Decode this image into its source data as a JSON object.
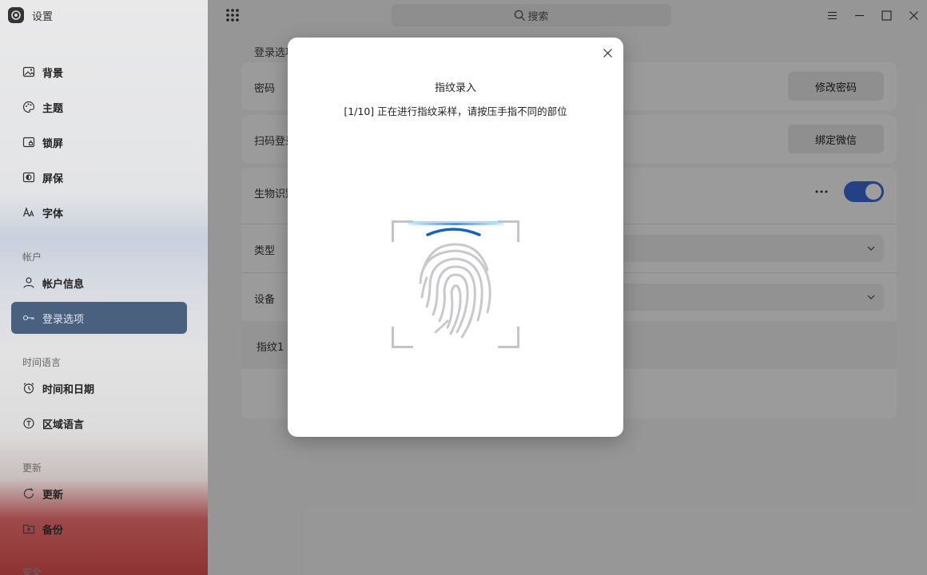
{
  "app": {
    "title": "设置",
    "icon": "settings-app-icon"
  },
  "sidebar": {
    "items": [
      {
        "label": "背景",
        "icon": "image-icon"
      },
      {
        "label": "主题",
        "icon": "palette-icon"
      },
      {
        "label": "锁屏",
        "icon": "lockscreen-icon"
      },
      {
        "label": "屏保",
        "icon": "screensaver-icon"
      },
      {
        "label": "字体",
        "icon": "font-icon"
      }
    ],
    "sections": [
      {
        "title": "帐户",
        "items": [
          {
            "label": "帐户信息",
            "icon": "user-icon"
          },
          {
            "label": "登录选项",
            "icon": "key-icon",
            "active": true
          }
        ]
      },
      {
        "title": "时间语言",
        "items": [
          {
            "label": "时间和日期",
            "icon": "clock-icon"
          },
          {
            "label": "区域语言",
            "icon": "language-icon"
          }
        ]
      },
      {
        "title": "更新",
        "items": [
          {
            "label": "更新",
            "icon": "refresh-icon"
          },
          {
            "label": "备份",
            "icon": "backup-icon"
          }
        ]
      },
      {
        "title": "安全"
      }
    ]
  },
  "topbar": {
    "search_placeholder": "搜索",
    "icons": [
      "app-grid-icon",
      "menu-icon",
      "minimize-icon",
      "maximize-icon",
      "close-icon"
    ]
  },
  "main": {
    "breadcrumb": "登录选项",
    "password": {
      "label": "密码",
      "button": "修改密码"
    },
    "qrcode": {
      "label": "扫码登录",
      "button": "绑定微信"
    },
    "biometric": {
      "label": "生物识别",
      "toggle_on": true
    },
    "type": {
      "label": "类型"
    },
    "device": {
      "label": "设备"
    },
    "fingerprint_item": {
      "label": "指纹1"
    }
  },
  "dialog": {
    "title": "指纹录入",
    "message": "[1/10] 正在进行指纹采样，请按压手指不同的部位",
    "progress": "1/10",
    "icon": "fingerprint-icon",
    "accent": "#1a73d9"
  }
}
